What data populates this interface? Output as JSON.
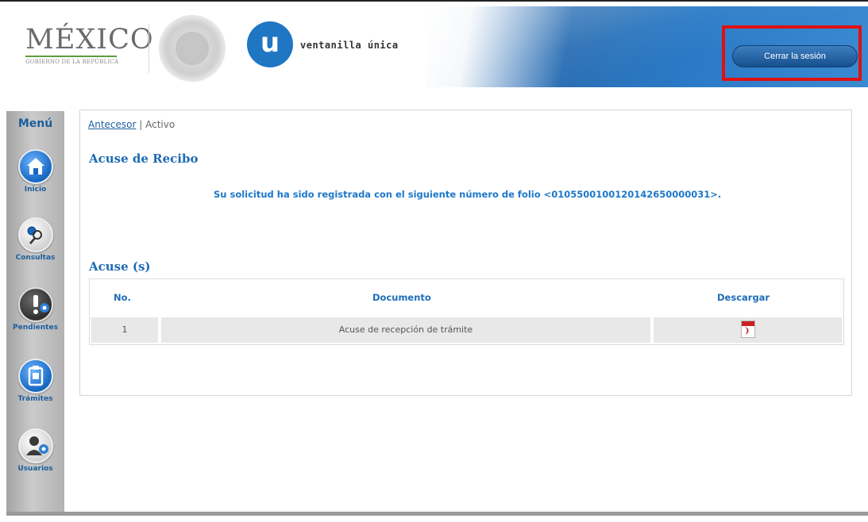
{
  "header": {
    "logo_title": "MÉXICO",
    "logo_subtitle": "GOBIERNO DE LA REPÚBLICA",
    "vu_letter": "u",
    "vu_name": "ventanilla única",
    "logout_label": "Cerrar la sesión",
    "highlight_color": "#e01010"
  },
  "sidebar": {
    "title": "Menú",
    "items": [
      {
        "label": "Inicio",
        "icon": "home-icon"
      },
      {
        "label": "Consultas",
        "icon": "search-icon"
      },
      {
        "label": "Pendientes",
        "icon": "alert-icon"
      },
      {
        "label": "Trámites",
        "icon": "clipboard-icon"
      },
      {
        "label": "Usuarios",
        "icon": "users-icon"
      }
    ]
  },
  "breadcrumb": {
    "link": "Antecesor",
    "separator": "|",
    "current": "Activo"
  },
  "main": {
    "heading": "Acuse de Recibo",
    "message": "Su solicitud ha sido registrada con el siguiente número de folio <0105500100120142650000031>.",
    "table_heading": "Acuse (s)"
  },
  "table": {
    "columns": [
      "No.",
      "Documento",
      "Descargar"
    ],
    "rows": [
      {
        "no": "1",
        "documento": "Acuse de recepción de trámite",
        "descargar_icon": "pdf-icon"
      }
    ]
  },
  "colors": {
    "accent": "#1e6bb2",
    "brand_blue": "#1f76c3",
    "logo_green": "#5a9e3c"
  }
}
